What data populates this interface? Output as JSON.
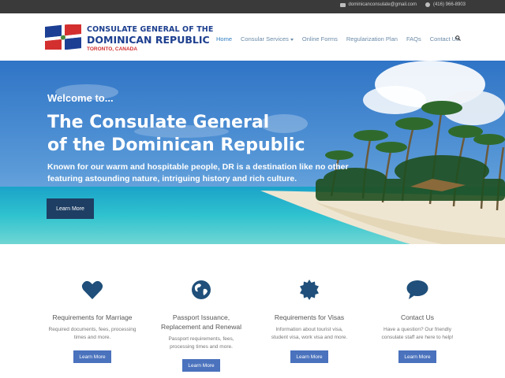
{
  "colors": {
    "topbar": "#3a3a3a",
    "brand": "#1d3f8f",
    "accent_red": "#d32f2f",
    "nav_active": "#2f7dc1",
    "hero_button": "#1e3e63",
    "feature_icon": "#1f4f7a",
    "feature_button": "#4a72bd"
  },
  "topbar": {
    "email": "dominicanconsulate@gmail.com",
    "phone": "(416) 966-8903",
    "email_icon": "envelope-icon",
    "phone_icon": "phone-icon"
  },
  "brand": {
    "line1": "CONSULATE GENERAL OF THE",
    "line2": "DOMINICAN REPUBLIC",
    "line3": "TORONTO, CANADA",
    "logo": "dominican-flag-icon"
  },
  "nav": {
    "items": [
      {
        "label": "Home",
        "active": true
      },
      {
        "label": "Consular Services",
        "dropdown": true
      },
      {
        "label": "Online Forms"
      },
      {
        "label": "Regularization Plan"
      },
      {
        "label": "FAQs"
      },
      {
        "label": "Contact Us"
      }
    ],
    "search_icon": "search-icon"
  },
  "hero": {
    "welcome": "Welcome to...",
    "headline_line1": "The Consulate General",
    "headline_line2": "of the Dominican Republic",
    "subtitle_line1": "Known for our warm and hospitable people, DR is a destination like no other",
    "subtitle_line2": "featuring astounding nature, intriguing history and rich culture.",
    "button": "Learn More"
  },
  "features": [
    {
      "icon": "heart-icon",
      "title_line1": "Requirements for Marriage",
      "title_line2": "",
      "desc_line1": "Required documents, fees, processing",
      "desc_line2": "times and more.",
      "button": "Learn More"
    },
    {
      "icon": "globe-icon",
      "title_line1": "Passport Issuance,",
      "title_line2": "Replacement and Renewal",
      "desc_line1": "Passport requirements, fees,",
      "desc_line2": "processing times and more.",
      "button": "Learn More"
    },
    {
      "icon": "certificate-icon",
      "title_line1": "Requirements for Visas",
      "title_line2": "",
      "desc_line1": "Information about tourist visa,",
      "desc_line2": "student visa, work visa and more.",
      "button": "Learn More"
    },
    {
      "icon": "chat-bubble-icon",
      "title_line1": "Contact Us",
      "title_line2": "",
      "desc_line1": "Have a question? Our friendly",
      "desc_line2": "consulate staff are here to help!",
      "button": "Learn More"
    }
  ]
}
